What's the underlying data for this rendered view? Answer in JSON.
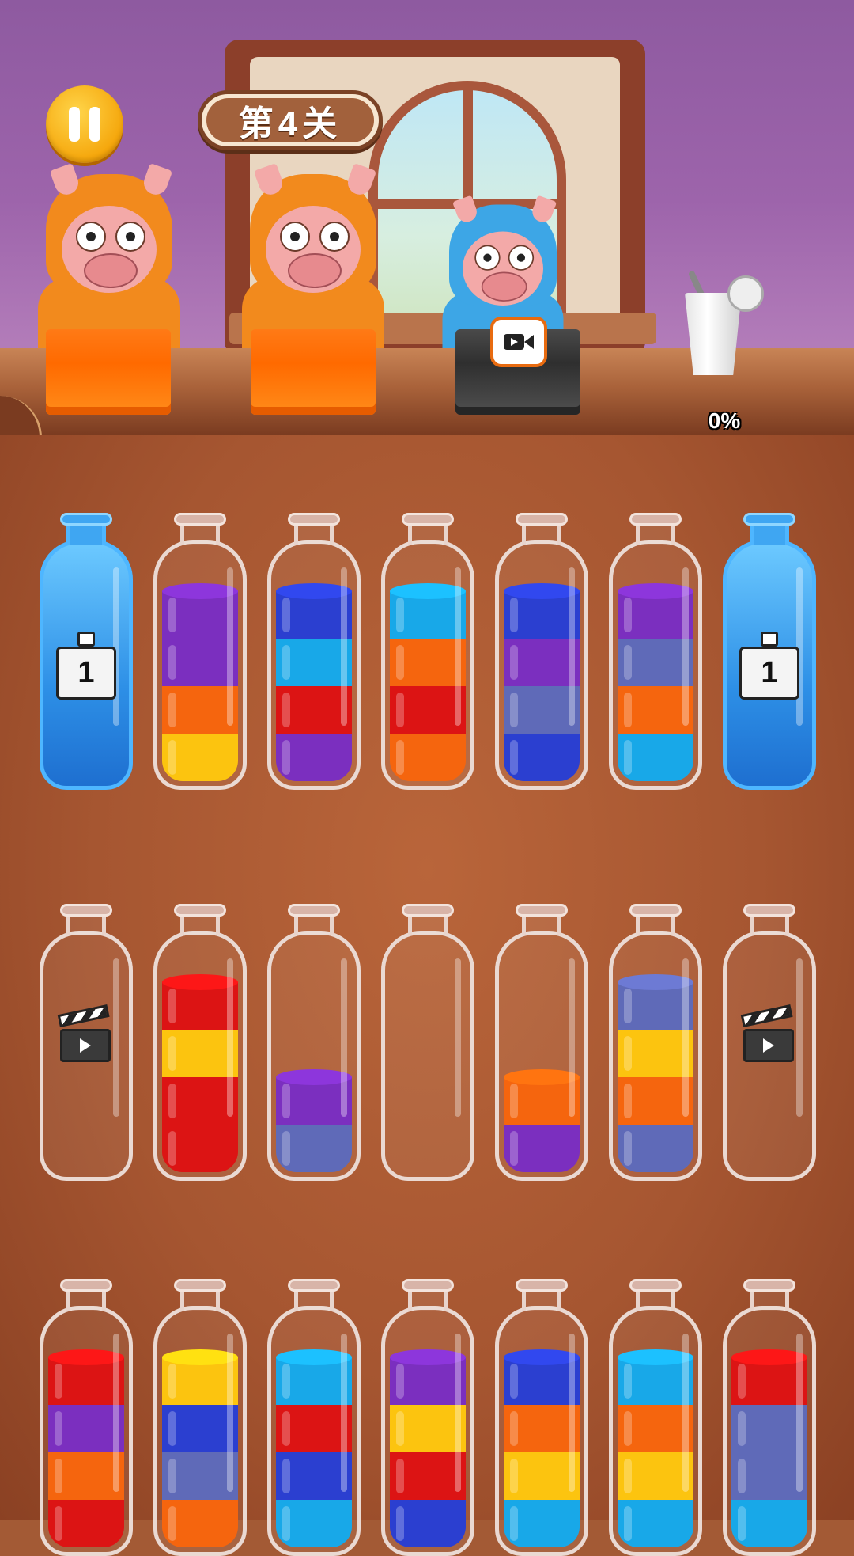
{
  "header": {
    "level_label": "第4关",
    "drink_progress": "0%",
    "drink_progress_value": 0
  },
  "colors": {
    "purple": "#7b2fbf",
    "blue": "#2b3fd0",
    "cyan": "#18a8e8",
    "orange": "#f5650e",
    "yellow": "#fcc40f",
    "red": "#dc1414",
    "slate": "#5f6ab8"
  },
  "icons": {
    "pause": "pause-icon",
    "video": "video-camera-icon",
    "lock": "bottle-lock-icon",
    "ad": "clapperboard-icon",
    "drink": "milkshake-cup-icon"
  },
  "customers": [
    {
      "suit": "orange",
      "box": "orange"
    },
    {
      "suit": "orange",
      "box": "orange"
    },
    {
      "suit": "blue",
      "box": "dark",
      "badge": "video"
    }
  ],
  "rows": [
    [
      {
        "state": "locked",
        "lock_count": "1",
        "layers": []
      },
      {
        "state": "normal",
        "layers": [
          "yellow",
          "orange",
          "purple",
          "purple"
        ]
      },
      {
        "state": "normal",
        "layers": [
          "purple",
          "red",
          "cyan",
          "blue"
        ]
      },
      {
        "state": "normal",
        "layers": [
          "orange",
          "red",
          "orange",
          "cyan"
        ]
      },
      {
        "state": "normal",
        "layers": [
          "blue",
          "slate",
          "purple",
          "blue"
        ]
      },
      {
        "state": "normal",
        "layers": [
          "cyan",
          "orange",
          "slate",
          "purple"
        ]
      },
      {
        "state": "locked",
        "lock_count": "1",
        "layers": []
      }
    ],
    [
      {
        "state": "ad",
        "layers": []
      },
      {
        "state": "normal",
        "layers": [
          "red",
          "red",
          "yellow",
          "red"
        ]
      },
      {
        "state": "normal",
        "layers": [
          "slate",
          "purple"
        ]
      },
      {
        "state": "normal",
        "layers": []
      },
      {
        "state": "normal",
        "layers": [
          "purple",
          "orange"
        ]
      },
      {
        "state": "normal",
        "layers": [
          "slate",
          "orange",
          "yellow",
          "slate"
        ]
      },
      {
        "state": "ad",
        "layers": []
      }
    ],
    [
      {
        "state": "normal",
        "layers": [
          "red",
          "orange",
          "purple",
          "red"
        ]
      },
      {
        "state": "normal",
        "layers": [
          "orange",
          "slate",
          "blue",
          "yellow"
        ]
      },
      {
        "state": "normal",
        "layers": [
          "cyan",
          "blue",
          "red",
          "cyan"
        ]
      },
      {
        "state": "normal",
        "layers": [
          "blue",
          "red",
          "yellow",
          "purple"
        ]
      },
      {
        "state": "normal",
        "layers": [
          "cyan",
          "yellow",
          "orange",
          "blue"
        ]
      },
      {
        "state": "normal",
        "layers": [
          "cyan",
          "yellow",
          "orange",
          "cyan"
        ]
      },
      {
        "state": "normal",
        "layers": [
          "cyan",
          "slate",
          "slate",
          "red"
        ]
      }
    ]
  ]
}
